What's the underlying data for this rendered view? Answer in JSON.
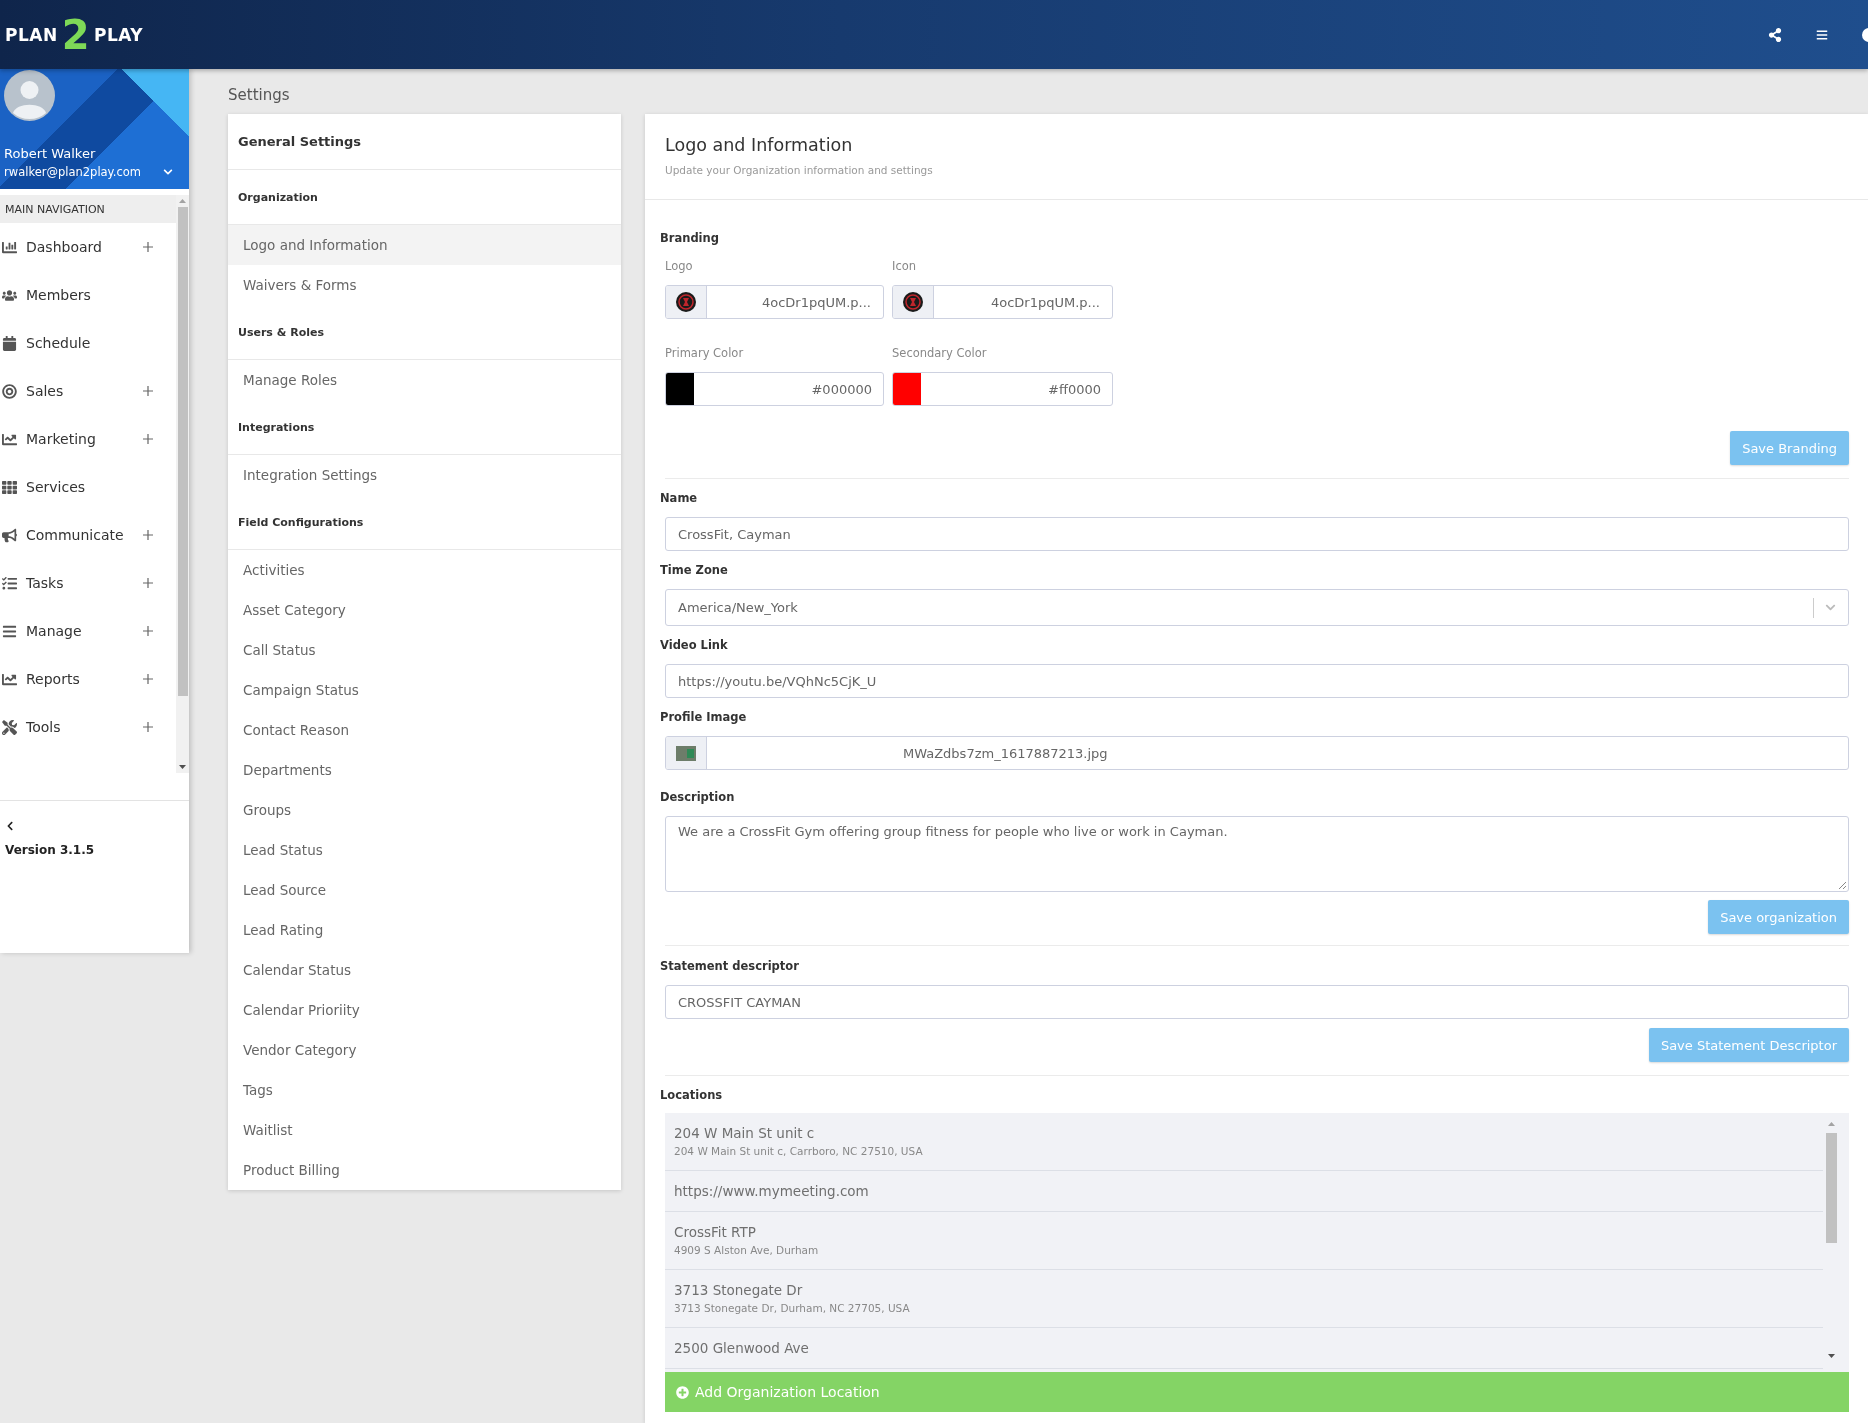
{
  "header": {
    "logo": {
      "left": "PLAN",
      "digit": "2",
      "right": "PLAY"
    }
  },
  "profile": {
    "name": "Robert Walker",
    "email": "rwalker@plan2play.com"
  },
  "sidebar": {
    "heading": "MAIN NAVIGATION",
    "items": [
      {
        "label": "Dashboard",
        "expandable": true
      },
      {
        "label": "Members",
        "expandable": false
      },
      {
        "label": "Schedule",
        "expandable": false
      },
      {
        "label": "Sales",
        "expandable": true
      },
      {
        "label": "Marketing",
        "expandable": true
      },
      {
        "label": "Services",
        "expandable": false
      },
      {
        "label": "Communicate",
        "expandable": true
      },
      {
        "label": "Tasks",
        "expandable": true
      },
      {
        "label": "Manage",
        "expandable": true
      },
      {
        "label": "Reports",
        "expandable": true
      },
      {
        "label": "Tools",
        "expandable": true
      }
    ],
    "version": "Version 3.1.5"
  },
  "page_title": "Settings",
  "settings_menu": {
    "title": "General Settings",
    "sections": [
      {
        "heading": "Organization",
        "items": [
          {
            "label": "Logo and Information",
            "selected": true
          },
          {
            "label": "Waivers & Forms",
            "selected": false
          }
        ]
      },
      {
        "heading": "Users & Roles",
        "items": [
          {
            "label": "Manage Roles",
            "selected": false
          }
        ]
      },
      {
        "heading": "Integrations",
        "items": [
          {
            "label": "Integration Settings",
            "selected": false
          }
        ]
      },
      {
        "heading": "Field Configurations",
        "items": [
          {
            "label": "Activities",
            "selected": false
          },
          {
            "label": "Asset Category",
            "selected": false
          },
          {
            "label": "Call Status",
            "selected": false
          },
          {
            "label": "Campaign Status",
            "selected": false
          },
          {
            "label": "Contact Reason",
            "selected": false
          },
          {
            "label": "Departments",
            "selected": false
          },
          {
            "label": "Groups",
            "selected": false
          },
          {
            "label": "Lead Status",
            "selected": false
          },
          {
            "label": "Lead Source",
            "selected": false
          },
          {
            "label": "Lead Rating",
            "selected": false
          },
          {
            "label": "Calendar Status",
            "selected": false
          },
          {
            "label": "Calendar Prioriity",
            "selected": false
          },
          {
            "label": "Vendor Category",
            "selected": false
          },
          {
            "label": "Tags",
            "selected": false
          },
          {
            "label": "Waitlist",
            "selected": false
          },
          {
            "label": "Product Billing",
            "selected": false
          }
        ]
      }
    ]
  },
  "panel": {
    "title": "Logo and Information",
    "subtitle": "Update your Organization information and settings",
    "branding": {
      "heading": "Branding",
      "files": [
        {
          "label": "Logo",
          "file": "4ocDr1pqUM.p..."
        },
        {
          "label": "Icon",
          "file": "4ocDr1pqUM.p..."
        }
      ],
      "colors": [
        {
          "label": "Primary Color",
          "value": "#000000",
          "color": "#000000"
        },
        {
          "label": "Secondary Color",
          "value": "#ff0000",
          "color": "#ff0000"
        }
      ],
      "save_button": "Save Branding"
    },
    "fields": [
      {
        "kind": "text",
        "label": "Name",
        "value": "CrossFit, Cayman"
      },
      {
        "kind": "select",
        "label": "Time Zone",
        "value": "America/New_York"
      },
      {
        "kind": "text",
        "label": "Video Link",
        "value": "https://youtu.be/VQhNc5CjK_U"
      },
      {
        "kind": "image",
        "label": "Profile Image",
        "value": "MWaZdbs7zm_1617887213.jpg"
      },
      {
        "kind": "textarea",
        "label": "Description",
        "value": "We are a CrossFit Gym offering group fitness for people who live or work in Cayman."
      }
    ],
    "save_organization_button": "Save organization",
    "statement": {
      "label": "Statement descriptor",
      "value": "CROSSFIT CAYMAN",
      "save_button": "Save Statement Descriptor"
    },
    "locations": {
      "heading": "Locations",
      "items": [
        {
          "name": "204 W Main St unit c",
          "address": "204 W Main St unit c, Carrboro, NC 27510, USA"
        },
        {
          "name": "https://www.mymeeting.com"
        },
        {
          "name": "CrossFit RTP",
          "address": "4909 S Alston Ave, Durham"
        },
        {
          "name": "3713 Stonegate Dr",
          "address": "3713 Stonegate Dr, Durham, NC 27705, USA"
        },
        {
          "name": "2500 Glenwood Ave"
        }
      ],
      "add_button": "Add Organization Location"
    }
  }
}
